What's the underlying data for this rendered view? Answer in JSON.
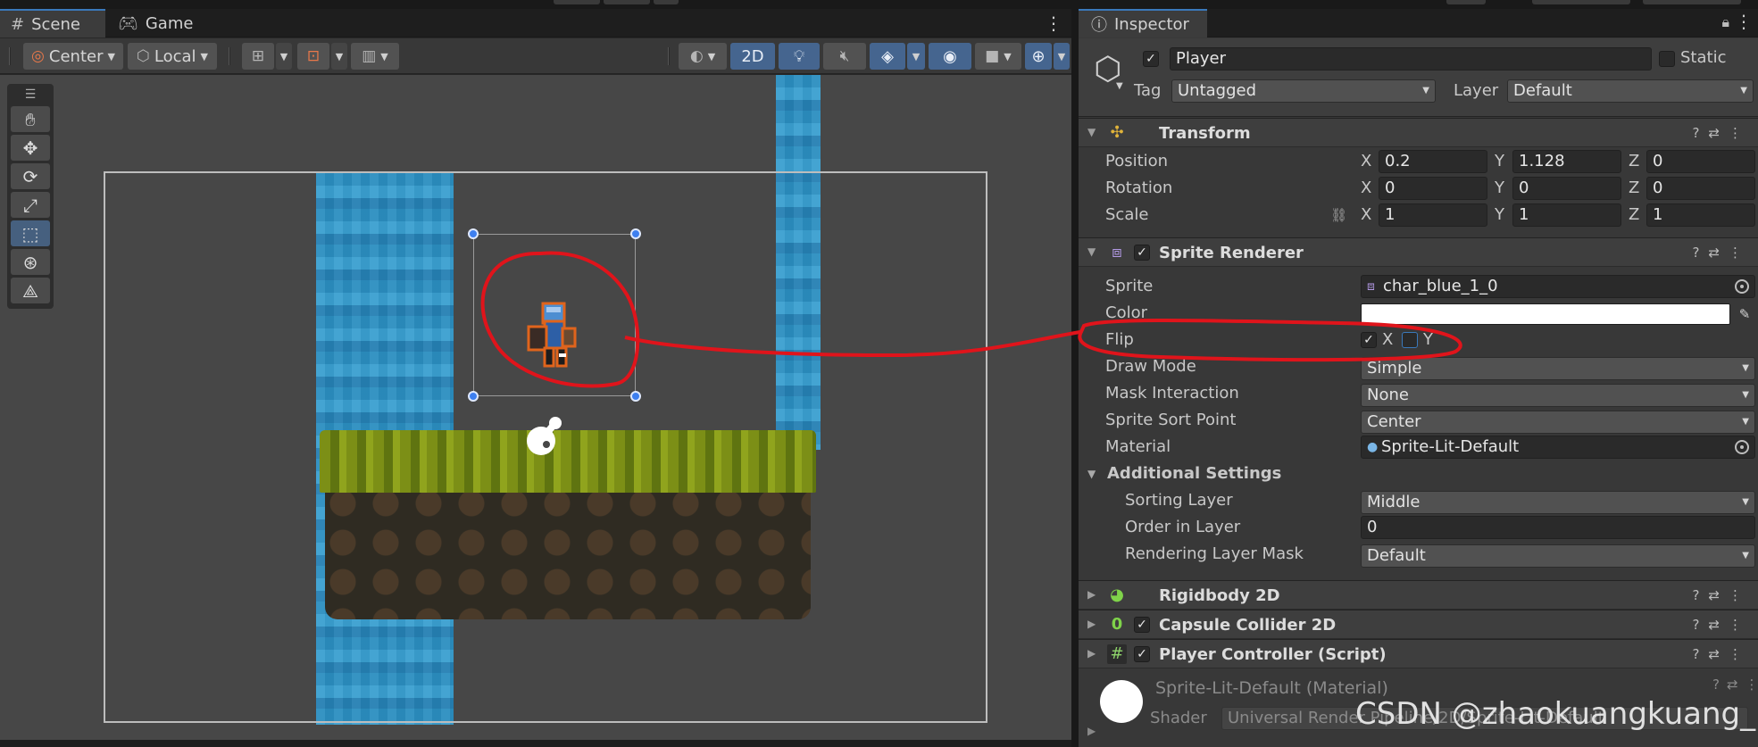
{
  "scene_window": {
    "tabs": [
      {
        "label": "Scene",
        "icon": "grid-hash-icon",
        "active": true
      },
      {
        "label": "Game",
        "icon": "gamepad-icon",
        "active": false
      }
    ],
    "toolbar": {
      "pivot": "Center",
      "space": "Local",
      "mode_2d": "2D"
    },
    "tools": [
      "hand-tool",
      "move-tool",
      "rotate-tool",
      "scale-tool",
      "rect-tool",
      "transform-tool",
      "custom-tool"
    ],
    "active_tool": "rect-tool"
  },
  "inspector": {
    "tab_label": "Inspector",
    "gameobject": {
      "active": true,
      "name": "Player",
      "static_label": "Static",
      "tag_label": "Tag",
      "tag": "Untagged",
      "layer_label": "Layer",
      "layer": "Default"
    },
    "transform": {
      "title": "Transform",
      "rows": [
        {
          "label": "Position",
          "x": "0.2",
          "y": "1.128",
          "z": "0"
        },
        {
          "label": "Rotation",
          "x": "0",
          "y": "0",
          "z": "0"
        },
        {
          "label": "Scale",
          "x": "1",
          "y": "1",
          "z": "1"
        }
      ]
    },
    "sprite_renderer": {
      "title": "Sprite Renderer",
      "enabled": true,
      "sprite_label": "Sprite",
      "sprite": "char_blue_1_0",
      "color_label": "Color",
      "color": "#ffffff",
      "flip_label": "Flip",
      "flip_x": true,
      "flip_x_label": "X",
      "flip_y": false,
      "flip_y_label": "Y",
      "draw_mode_label": "Draw Mode",
      "draw_mode": "Simple",
      "mask_interaction_label": "Mask Interaction",
      "mask_interaction": "None",
      "sort_point_label": "Sprite Sort Point",
      "sort_point": "Center",
      "material_label": "Material",
      "material": "Sprite-Lit-Default",
      "additional_settings_label": "Additional Settings",
      "sorting_layer_label": "Sorting Layer",
      "sorting_layer": "Middle",
      "order_in_layer_label": "Order in Layer",
      "order_in_layer": "0",
      "rendering_layer_mask_label": "Rendering Layer Mask",
      "rendering_layer_mask": "Default"
    },
    "components": [
      {
        "title": "Rigidbody 2D"
      },
      {
        "title": "Capsule Collider 2D",
        "enabled": true
      },
      {
        "title": "Player Controller (Script)",
        "enabled": true
      }
    ],
    "material_preview": {
      "title": "Sprite-Lit-Default (Material)",
      "shader_label": "Shader",
      "shader": "Universal Render Pipeline/2D/Sprite-Lit-Default"
    }
  },
  "watermark": "CSDN @zhaokuangkuang_",
  "colors": {
    "accent_blue": "#3a79bb",
    "annotation_red": "#e0141b",
    "waterfall": "#2b8ec0",
    "grass": "#7c8f16"
  }
}
